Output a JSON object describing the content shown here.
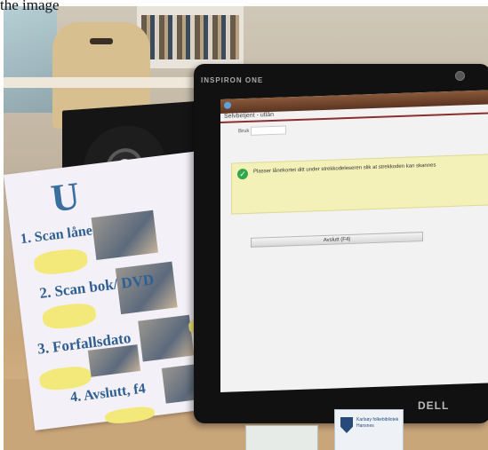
{
  "caption": "the image",
  "sign": {
    "title": "U",
    "steps": [
      "1. Scan låne",
      "2. Scan bok/ DVD",
      "3. Forfallsdato",
      "4. Avslutt, f4"
    ]
  },
  "monitor": {
    "brand_top": "INSPIRON ONE",
    "brand_bottom": "DELL"
  },
  "app": {
    "window_title": "Selvbetjent - utlån",
    "field_label": "Bruk",
    "message": "Plasser lånekortet ditt under strekkodeleseren slik at strekkoden kan skannes",
    "finish_button": "Avslutt (F4)"
  },
  "desk_card": {
    "text": "Karlsøy folkebibliotek\nHansnes"
  },
  "colors": {
    "sign_text": "#2f5f92",
    "message_bg": "#f3f1b8",
    "title_rule": "#8b2e2e",
    "check": "#2ea84a"
  },
  "icons": [
    "check-icon",
    "camera-icon",
    "library-logo-icon"
  ]
}
